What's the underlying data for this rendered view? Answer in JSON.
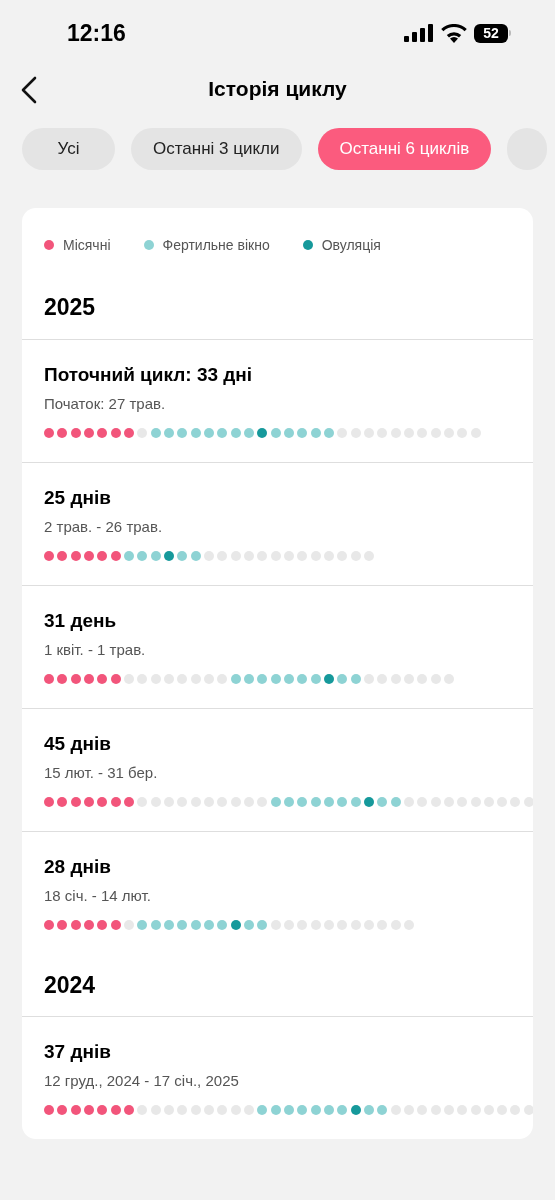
{
  "status_bar": {
    "time": "12:16",
    "battery": "52"
  },
  "header": {
    "title": "Історія циклу"
  },
  "filters": [
    {
      "label": "Усі",
      "selected": false
    },
    {
      "label": "Останні 3 цикли",
      "selected": false
    },
    {
      "label": "Останні 6 циклів",
      "selected": true
    },
    {
      "selected": false
    }
  ],
  "legend": [
    {
      "label": "Місячні",
      "kind": "period"
    },
    {
      "label": "Фертильне вікно",
      "kind": "fertile"
    },
    {
      "label": "Овуляція",
      "kind": "ovulation"
    }
  ],
  "sections": [
    {
      "year": "2025",
      "cycles": [
        {
          "title": "Поточний цикл: 33 дні",
          "dates": "Початок: 27 трав.",
          "days": [
            {
              "kind": "period"
            },
            {
              "kind": "period"
            },
            {
              "kind": "period"
            },
            {
              "kind": "period"
            },
            {
              "kind": "period"
            },
            {
              "kind": "period"
            },
            {
              "kind": "period"
            },
            {
              "kind": "none"
            },
            {
              "kind": "fertile"
            },
            {
              "kind": "fertile"
            },
            {
              "kind": "fertile"
            },
            {
              "kind": "fertile"
            },
            {
              "kind": "fertile"
            },
            {
              "kind": "fertile"
            },
            {
              "kind": "fertile"
            },
            {
              "kind": "fertile"
            },
            {
              "kind": "ovulation"
            },
            {
              "kind": "fertile"
            },
            {
              "kind": "fertile"
            },
            {
              "kind": "fertile"
            },
            {
              "kind": "fertile"
            },
            {
              "kind": "fertile"
            },
            {
              "kind": "none"
            },
            {
              "kind": "none"
            },
            {
              "kind": "none"
            },
            {
              "kind": "none"
            },
            {
              "kind": "none"
            },
            {
              "kind": "none"
            },
            {
              "kind": "none"
            },
            {
              "kind": "none"
            },
            {
              "kind": "none"
            },
            {
              "kind": "none"
            },
            {
              "kind": "none"
            }
          ]
        },
        {
          "title": "25 днів",
          "dates": "2 трав. - 26 трав.",
          "days": [
            {
              "kind": "period"
            },
            {
              "kind": "period"
            },
            {
              "kind": "period"
            },
            {
              "kind": "period"
            },
            {
              "kind": "period"
            },
            {
              "kind": "period"
            },
            {
              "kind": "fertile"
            },
            {
              "kind": "fertile"
            },
            {
              "kind": "fertile"
            },
            {
              "kind": "ovulation"
            },
            {
              "kind": "fertile"
            },
            {
              "kind": "fertile"
            },
            {
              "kind": "none"
            },
            {
              "kind": "none"
            },
            {
              "kind": "none"
            },
            {
              "kind": "none"
            },
            {
              "kind": "none"
            },
            {
              "kind": "none"
            },
            {
              "kind": "none"
            },
            {
              "kind": "none"
            },
            {
              "kind": "none"
            },
            {
              "kind": "none"
            },
            {
              "kind": "none"
            },
            {
              "kind": "none"
            },
            {
              "kind": "none"
            }
          ]
        },
        {
          "title": "31 день",
          "dates": "1 квіт. - 1 трав.",
          "days": [
            {
              "kind": "period"
            },
            {
              "kind": "period"
            },
            {
              "kind": "period"
            },
            {
              "kind": "period"
            },
            {
              "kind": "period"
            },
            {
              "kind": "period"
            },
            {
              "kind": "none"
            },
            {
              "kind": "none"
            },
            {
              "kind": "none"
            },
            {
              "kind": "none"
            },
            {
              "kind": "none"
            },
            {
              "kind": "none"
            },
            {
              "kind": "none"
            },
            {
              "kind": "none"
            },
            {
              "kind": "fertile"
            },
            {
              "kind": "fertile"
            },
            {
              "kind": "fertile"
            },
            {
              "kind": "fertile"
            },
            {
              "kind": "fertile"
            },
            {
              "kind": "fertile"
            },
            {
              "kind": "fertile"
            },
            {
              "kind": "ovulation"
            },
            {
              "kind": "fertile"
            },
            {
              "kind": "fertile"
            },
            {
              "kind": "none"
            },
            {
              "kind": "none"
            },
            {
              "kind": "none"
            },
            {
              "kind": "none"
            },
            {
              "kind": "none"
            },
            {
              "kind": "none"
            },
            {
              "kind": "none"
            }
          ]
        },
        {
          "title": "45 днів",
          "dates": "15 лют. - 31 бер.",
          "days": [
            {
              "kind": "period"
            },
            {
              "kind": "period"
            },
            {
              "kind": "period"
            },
            {
              "kind": "period"
            },
            {
              "kind": "period"
            },
            {
              "kind": "period"
            },
            {
              "kind": "period"
            },
            {
              "kind": "none"
            },
            {
              "kind": "none"
            },
            {
              "kind": "none"
            },
            {
              "kind": "none"
            },
            {
              "kind": "none"
            },
            {
              "kind": "none"
            },
            {
              "kind": "none"
            },
            {
              "kind": "none"
            },
            {
              "kind": "none"
            },
            {
              "kind": "none"
            },
            {
              "kind": "fertile"
            },
            {
              "kind": "fertile"
            },
            {
              "kind": "fertile"
            },
            {
              "kind": "fertile"
            },
            {
              "kind": "fertile"
            },
            {
              "kind": "fertile"
            },
            {
              "kind": "fertile"
            },
            {
              "kind": "ovulation"
            },
            {
              "kind": "fertile"
            },
            {
              "kind": "fertile"
            },
            {
              "kind": "none"
            },
            {
              "kind": "none"
            },
            {
              "kind": "none"
            },
            {
              "kind": "none"
            },
            {
              "kind": "none"
            },
            {
              "kind": "none"
            },
            {
              "kind": "none"
            },
            {
              "kind": "none"
            },
            {
              "kind": "none"
            },
            {
              "kind": "none"
            }
          ]
        },
        {
          "title": "28 днів",
          "dates": "18 січ. - 14 лют.",
          "days": [
            {
              "kind": "period"
            },
            {
              "kind": "period"
            },
            {
              "kind": "period"
            },
            {
              "kind": "period"
            },
            {
              "kind": "period"
            },
            {
              "kind": "period"
            },
            {
              "kind": "none"
            },
            {
              "kind": "fertile"
            },
            {
              "kind": "fertile"
            },
            {
              "kind": "fertile"
            },
            {
              "kind": "fertile"
            },
            {
              "kind": "fertile"
            },
            {
              "kind": "fertile"
            },
            {
              "kind": "fertile"
            },
            {
              "kind": "ovulation"
            },
            {
              "kind": "fertile"
            },
            {
              "kind": "fertile"
            },
            {
              "kind": "none"
            },
            {
              "kind": "none"
            },
            {
              "kind": "none"
            },
            {
              "kind": "none"
            },
            {
              "kind": "none"
            },
            {
              "kind": "none"
            },
            {
              "kind": "none"
            },
            {
              "kind": "none"
            },
            {
              "kind": "none"
            },
            {
              "kind": "none"
            },
            {
              "kind": "none"
            }
          ]
        }
      ]
    },
    {
      "year": "2024",
      "cycles": [
        {
          "title": "37 днів",
          "dates": "12 груд., 2024 - 17 січ., 2025",
          "days": [
            {
              "kind": "period"
            },
            {
              "kind": "period"
            },
            {
              "kind": "period"
            },
            {
              "kind": "period"
            },
            {
              "kind": "period"
            },
            {
              "kind": "period"
            },
            {
              "kind": "period"
            },
            {
              "kind": "none"
            },
            {
              "kind": "none"
            },
            {
              "kind": "none"
            },
            {
              "kind": "none"
            },
            {
              "kind": "none"
            },
            {
              "kind": "none"
            },
            {
              "kind": "none"
            },
            {
              "kind": "none"
            },
            {
              "kind": "none"
            },
            {
              "kind": "fertile"
            },
            {
              "kind": "fertile"
            },
            {
              "kind": "fertile"
            },
            {
              "kind": "fertile"
            },
            {
              "kind": "fertile"
            },
            {
              "kind": "fertile"
            },
            {
              "kind": "fertile"
            },
            {
              "kind": "ovulation"
            },
            {
              "kind": "fertile"
            },
            {
              "kind": "fertile"
            },
            {
              "kind": "none"
            },
            {
              "kind": "none"
            },
            {
              "kind": "none"
            },
            {
              "kind": "none"
            },
            {
              "kind": "none"
            },
            {
              "kind": "none"
            },
            {
              "kind": "none"
            },
            {
              "kind": "none"
            },
            {
              "kind": "none"
            },
            {
              "kind": "none"
            },
            {
              "kind": "none"
            }
          ]
        }
      ]
    }
  ]
}
